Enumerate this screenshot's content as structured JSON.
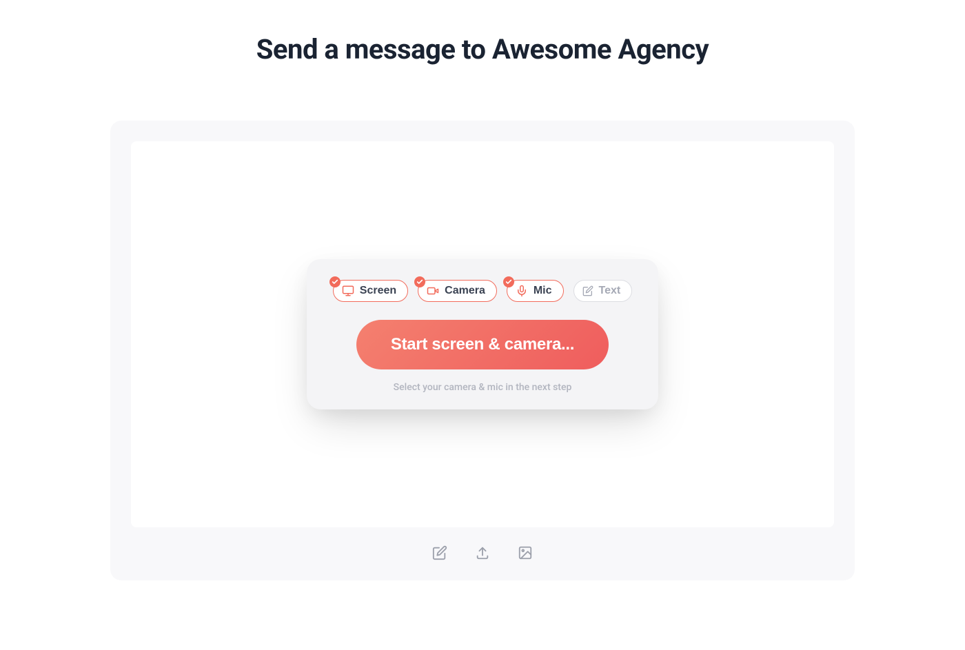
{
  "title": "Send a message to Awesome Agency",
  "chips": {
    "screen": {
      "label": "Screen",
      "active": true
    },
    "camera": {
      "label": "Camera",
      "active": true
    },
    "mic": {
      "label": "Mic",
      "active": true
    },
    "text": {
      "label": "Text",
      "active": false
    }
  },
  "startButton": {
    "label": "Start screen & camera..."
  },
  "helperText": "Select your camera & mic in the next step",
  "toolbar": {
    "edit": {
      "name": "edit"
    },
    "upload": {
      "name": "upload"
    },
    "image": {
      "name": "image"
    }
  },
  "colors": {
    "accent": "#f26b5b",
    "textDark": "#1a2332",
    "muted": "#a5a9b5"
  }
}
